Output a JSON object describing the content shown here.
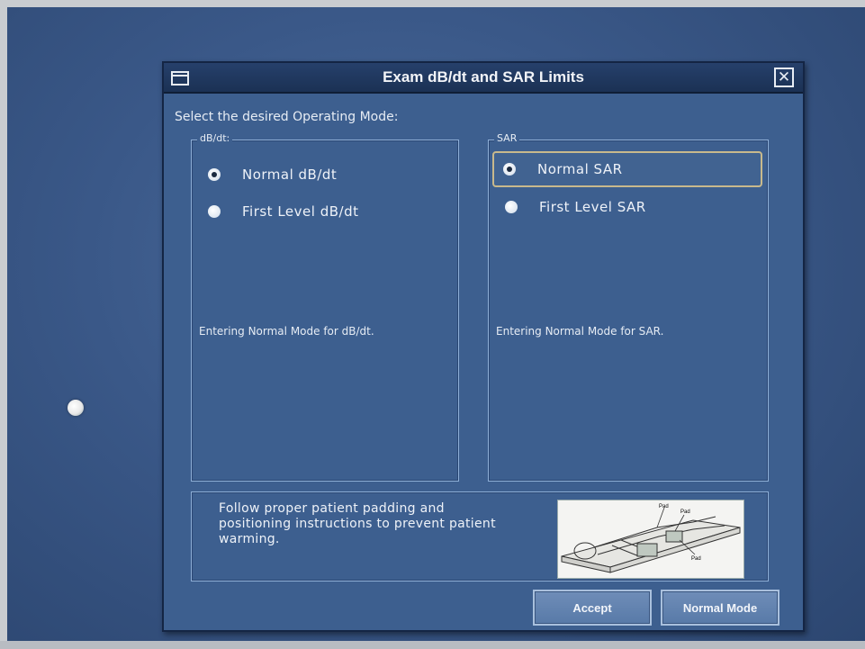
{
  "window": {
    "title": "Exam dB/dt and SAR Limits",
    "close_glyph": "✕"
  },
  "prompt": "Select the desired Operating Mode:",
  "dbdt": {
    "legend": "dB/dt:",
    "options": [
      "Normal dB/dt",
      "First Level dB/dt"
    ],
    "selected": "Normal dB/dt",
    "status": "Entering Normal Mode for dB/dt."
  },
  "sar": {
    "legend": "SAR",
    "options": [
      "Normal SAR",
      "First Level SAR"
    ],
    "selected": "Normal SAR",
    "status": "Entering Normal Mode for SAR."
  },
  "info": {
    "text": "Follow proper patient padding and positioning instructions to prevent patient warming.",
    "illustration_labels": [
      "Pad",
      "Pad",
      "Pad"
    ]
  },
  "buttons": {
    "accept": "Accept",
    "normal_mode": "Normal Mode"
  },
  "colors": {
    "window_bg": "#3d5f8f",
    "titlebar": "#1b3154",
    "focus_outline": "#c8b98c"
  },
  "icons": [
    "window-menu-icon",
    "close-icon",
    "cursor-icon"
  ]
}
